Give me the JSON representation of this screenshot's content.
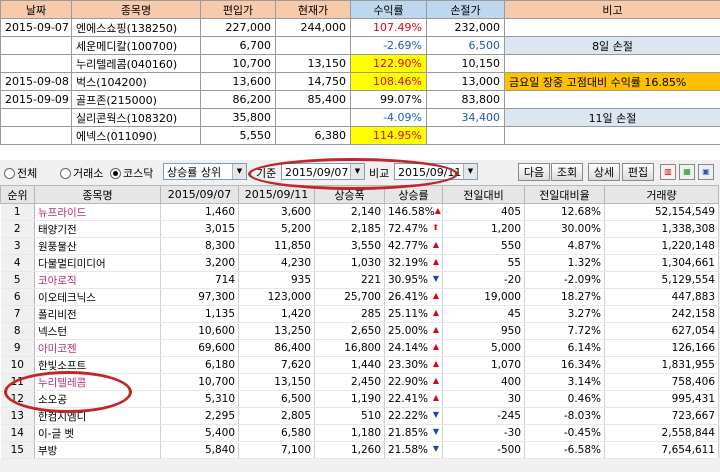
{
  "top_table": {
    "headers": [
      "날짜",
      "종목명",
      "편입가",
      "현재가",
      "수익률",
      "손절가",
      "비고"
    ],
    "rows": [
      {
        "date": "2015-09-07",
        "name": "엔에스쇼핑(138250)",
        "buy": "227,000",
        "cur": "244,000",
        "ret": "107.49%",
        "stop": "232,000",
        "note": ""
      },
      {
        "date": "",
        "name": "세운메디칼(100700)",
        "buy": "6,700",
        "cur": "",
        "ret": "-2.69%",
        "stop": "6,500",
        "note": "8일 손절"
      },
      {
        "date": "",
        "name": "누리텔레콤(040160)",
        "buy": "10,700",
        "cur": "13,150",
        "ret": "122.90%",
        "stop": "10,150",
        "note": ""
      },
      {
        "date": "2015-09-08",
        "name": "벅스(104200)",
        "buy": "13,600",
        "cur": "14,750",
        "ret": "108.46%",
        "stop": "13,000",
        "note": "금요일 장중 고점대비 수익률 16.85%"
      },
      {
        "date": "2015-09-09",
        "name": "골프존(215000)",
        "buy": "86,200",
        "cur": "85,400",
        "ret": "99.07%",
        "stop": "83,800",
        "note": ""
      },
      {
        "date": "",
        "name": "실리콘웍스(108320)",
        "buy": "35,800",
        "cur": "",
        "ret": "-4.09%",
        "stop": "34,400",
        "note": "11일 손절"
      },
      {
        "date": "",
        "name": "에넥스(011090)",
        "buy": "5,550",
        "cur": "6,380",
        "ret": "114.95%",
        "stop": "",
        "note": ""
      }
    ]
  },
  "toolbar": {
    "radio_all": "전체",
    "radio_exchange": "거래소",
    "radio_kosdaq": "코스닥",
    "sort_select": "상승률 상위",
    "base_label": "기준",
    "base_date": "2015/09/07",
    "compare_label": "비교",
    "compare_date": "2015/09/11",
    "next_btn": "다음",
    "query_btn": "조회",
    "detail_btn": "상세",
    "edit_btn": "편집"
  },
  "grid": {
    "headers": [
      "순위",
      "종목명",
      "2015/09/07",
      "2015/09/11",
      "상승폭",
      "상승률",
      "전일대비",
      "전일대비율",
      "거래량"
    ],
    "rows": [
      {
        "rank": "1",
        "name": "뉴프라이드",
        "a": "1,460",
        "b": "3,600",
        "gap": "2,140",
        "rate": "146.58%",
        "dir": "up",
        "chg": "405",
        "chgr": "12.68%",
        "vol": "52,154,549",
        "mag": true
      },
      {
        "rank": "2",
        "name": "태양기전",
        "a": "3,015",
        "b": "5,200",
        "gap": "2,185",
        "rate": "72.47%",
        "dir": "upbold",
        "chg": "1,200",
        "chgr": "30.00%",
        "vol": "1,338,308",
        "mag": false
      },
      {
        "rank": "3",
        "name": "원풍물산",
        "a": "8,300",
        "b": "11,850",
        "gap": "3,550",
        "rate": "42.77%",
        "dir": "up",
        "chg": "550",
        "chgr": "4.87%",
        "vol": "1,220,148",
        "mag": false
      },
      {
        "rank": "4",
        "name": "다물멀티미디어",
        "a": "3,200",
        "b": "4,230",
        "gap": "1,030",
        "rate": "32.19%",
        "dir": "up",
        "chg": "55",
        "chgr": "1.32%",
        "vol": "1,304,661",
        "mag": false
      },
      {
        "rank": "5",
        "name": "코아로직",
        "a": "714",
        "b": "935",
        "gap": "221",
        "rate": "30.95%",
        "dir": "down",
        "chg": "-20",
        "chgr": "-2.09%",
        "vol": "5,129,554",
        "mag": true
      },
      {
        "rank": "6",
        "name": "이오테크닉스",
        "a": "97,300",
        "b": "123,000",
        "gap": "25,700",
        "rate": "26.41%",
        "dir": "up",
        "chg": "19,000",
        "chgr": "18.27%",
        "vol": "447,883",
        "mag": false
      },
      {
        "rank": "7",
        "name": "폴리비전",
        "a": "1,135",
        "b": "1,420",
        "gap": "285",
        "rate": "25.11%",
        "dir": "up",
        "chg": "45",
        "chgr": "3.27%",
        "vol": "242,158",
        "mag": false
      },
      {
        "rank": "8",
        "name": "넥스턴",
        "a": "10,600",
        "b": "13,250",
        "gap": "2,650",
        "rate": "25.00%",
        "dir": "up",
        "chg": "950",
        "chgr": "7.72%",
        "vol": "627,054",
        "mag": false
      },
      {
        "rank": "9",
        "name": "아미코젠",
        "a": "69,600",
        "b": "86,400",
        "gap": "16,800",
        "rate": "24.14%",
        "dir": "up",
        "chg": "5,000",
        "chgr": "6.14%",
        "vol": "126,166",
        "mag": true
      },
      {
        "rank": "10",
        "name": "한빛소프트",
        "a": "6,180",
        "b": "7,620",
        "gap": "1,440",
        "rate": "23.30%",
        "dir": "up",
        "chg": "1,070",
        "chgr": "16.34%",
        "vol": "1,831,955",
        "mag": false
      },
      {
        "rank": "11",
        "name": "누리텔레콤",
        "a": "10,700",
        "b": "13,150",
        "gap": "2,450",
        "rate": "22.90%",
        "dir": "up",
        "chg": "400",
        "chgr": "3.14%",
        "vol": "758,406",
        "mag": true
      },
      {
        "rank": "12",
        "name": "소오공",
        "a": "5,310",
        "b": "6,500",
        "gap": "1,190",
        "rate": "22.41%",
        "dir": "up",
        "chg": "30",
        "chgr": "0.46%",
        "vol": "995,431",
        "mag": false
      },
      {
        "rank": "13",
        "name": "한컴지엠디",
        "a": "2,295",
        "b": "2,805",
        "gap": "510",
        "rate": "22.22%",
        "dir": "down",
        "chg": "-245",
        "chgr": "-8.03%",
        "vol": "723,667",
        "mag": false
      },
      {
        "rank": "14",
        "name": "이-글 벳",
        "a": "5,400",
        "b": "6,580",
        "gap": "1,180",
        "rate": "21.85%",
        "dir": "down",
        "chg": "-30",
        "chgr": "-0.45%",
        "vol": "2,558,844",
        "mag": false
      },
      {
        "rank": "15",
        "name": "부방",
        "a": "5,840",
        "b": "7,100",
        "gap": "1,260",
        "rate": "21.58%",
        "dir": "down",
        "chg": "-500",
        "chgr": "-6.58%",
        "vol": "7,654,611",
        "mag": false
      }
    ]
  },
  "colors": {
    "highlight_red": "#c0272d",
    "up": "#e0001a",
    "down": "#1f3fbf",
    "yellow": "#ffff00",
    "orange": "#ffc000"
  }
}
